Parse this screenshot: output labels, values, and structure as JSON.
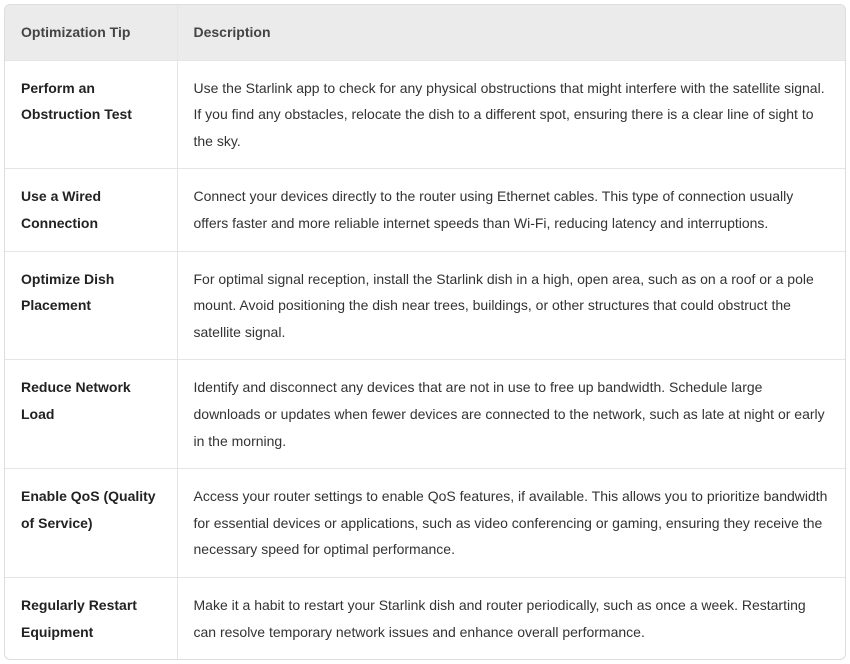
{
  "table": {
    "headers": {
      "tip": "Optimization Tip",
      "desc": "Description"
    },
    "rows": [
      {
        "tip": "Perform an Obstruction Test",
        "desc": "Use the Starlink app to check for any physical obstructions that might interfere with the satellite signal. If you find any obstacles, relocate the dish to a different spot, ensuring there is a clear line of sight to the sky."
      },
      {
        "tip": "Use a Wired Connection",
        "desc": "Connect your devices directly to the router using Ethernet cables. This type of connection usually offers faster and more reliable internet speeds than Wi-Fi, reducing latency and interruptions."
      },
      {
        "tip": "Optimize Dish Placement",
        "desc": "For optimal signal reception, install the Starlink dish in a high, open area, such as on a roof or a pole mount. Avoid positioning the dish near trees, buildings, or other structures that could obstruct the satellite signal."
      },
      {
        "tip": "Reduce Network Load",
        "desc": "Identify and disconnect any devices that are not in use to free up bandwidth. Schedule large downloads or updates when fewer devices are connected to the network, such as late at night or early in the morning."
      },
      {
        "tip": "Enable QoS (Quality of Service)",
        "desc": "Access your router settings to enable QoS features, if available. This allows you to prioritize bandwidth for essential devices or applications, such as video conferencing or gaming, ensuring they receive the necessary speed for optimal performance."
      },
      {
        "tip": "Regularly Restart Equipment",
        "desc": "Make it a habit to restart your Starlink dish and router periodically, such as once a week. Restarting can resolve temporary network issues and enhance overall performance."
      }
    ]
  }
}
